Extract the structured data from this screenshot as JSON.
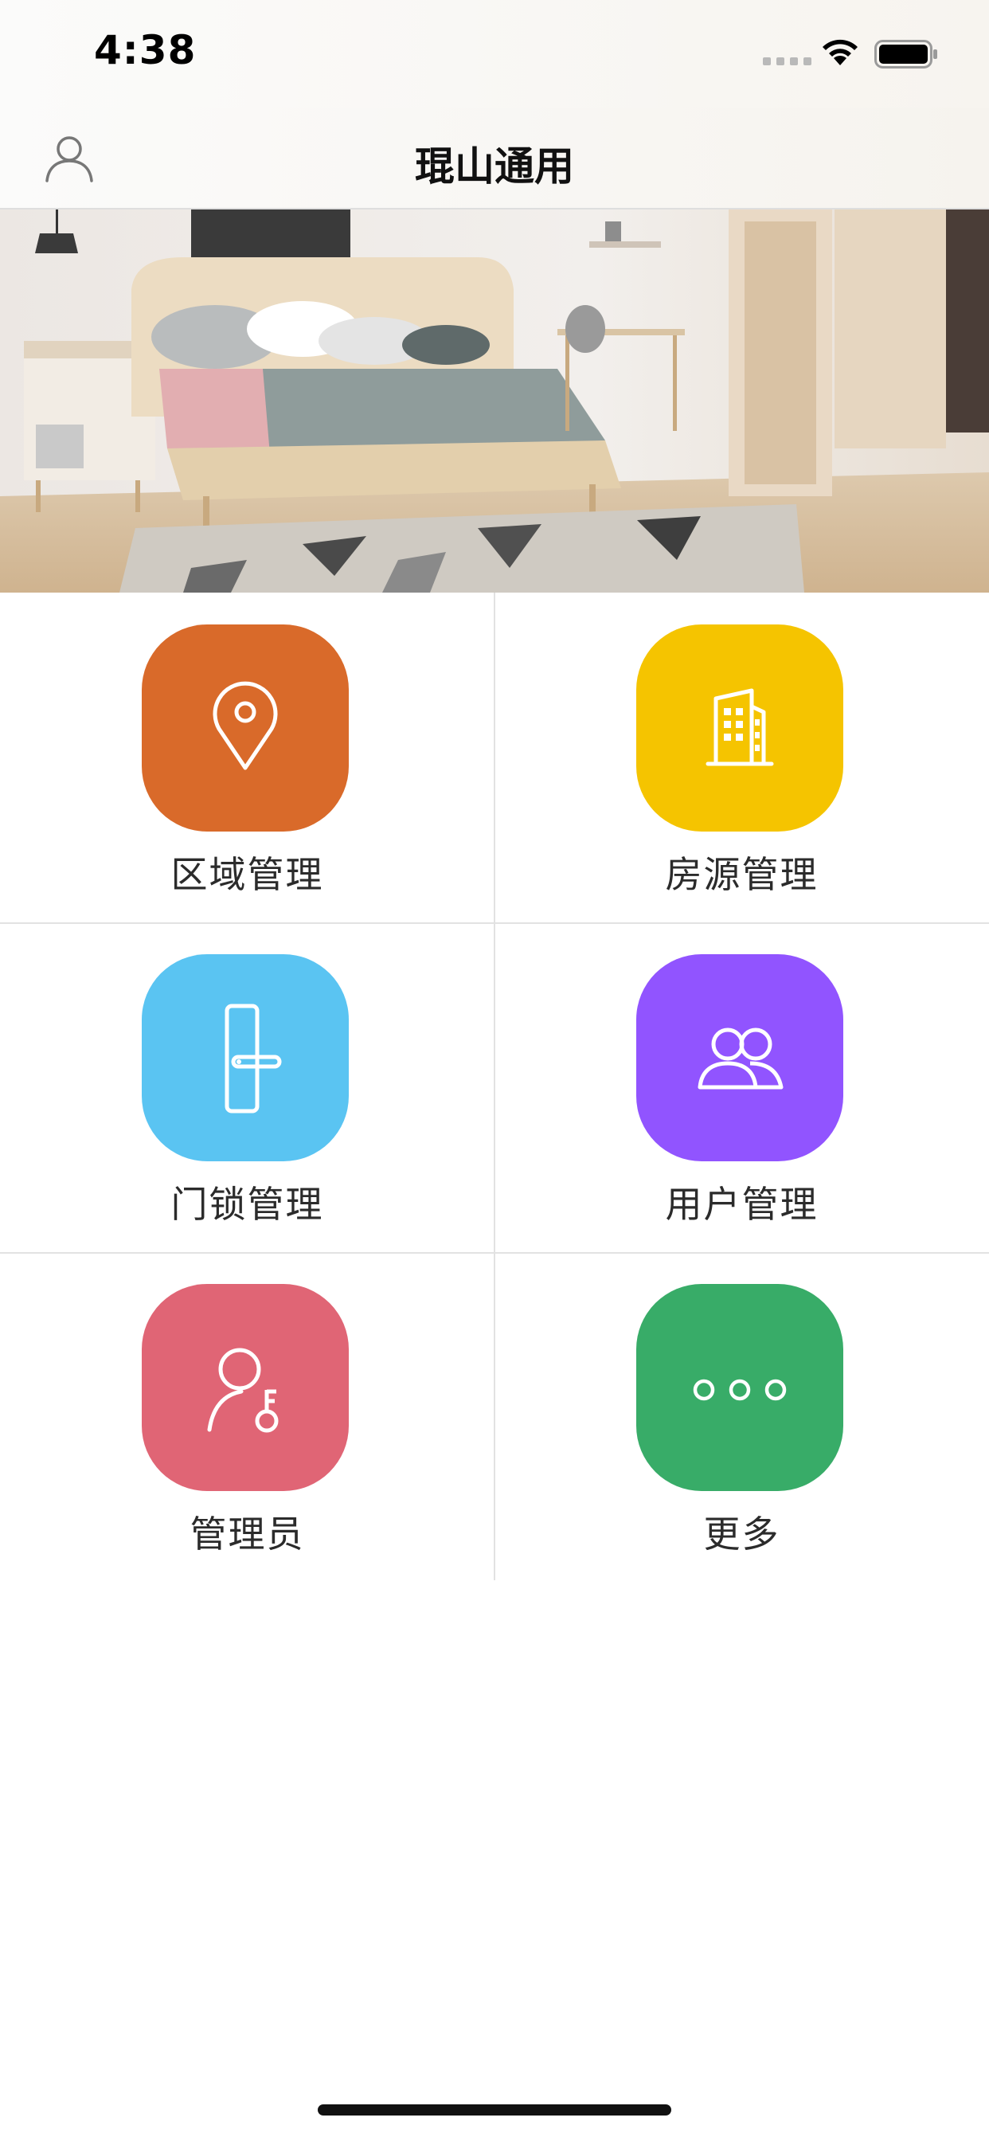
{
  "status_bar": {
    "time": "4:38"
  },
  "nav": {
    "title": "琨山通用",
    "profile_icon": "person-outline-icon"
  },
  "banner": {
    "image": "bedroom-photo"
  },
  "menu": {
    "items": [
      {
        "label": "区域管理",
        "icon": "location-pin-icon",
        "color": "#D96A2A"
      },
      {
        "label": "房源管理",
        "icon": "building-icon",
        "color": "#F5C400"
      },
      {
        "label": "门锁管理",
        "icon": "door-lock-icon",
        "color": "#5AC4F2"
      },
      {
        "label": "用户管理",
        "icon": "users-icon",
        "color": "#9154FF"
      },
      {
        "label": "管理员",
        "icon": "admin-key-icon",
        "color": "#E06575"
      },
      {
        "label": "更多",
        "icon": "more-dots-icon",
        "color": "#38AC68"
      }
    ]
  }
}
